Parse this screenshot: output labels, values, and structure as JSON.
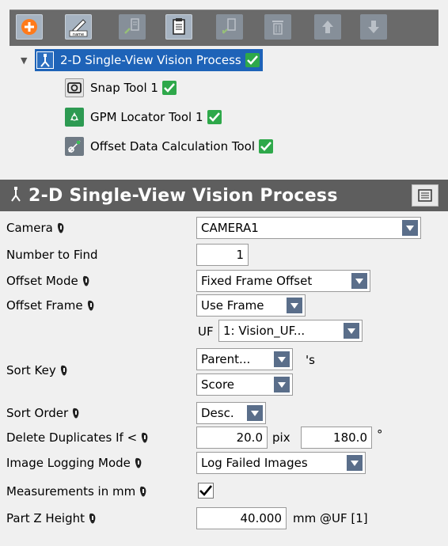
{
  "toolbar": {
    "buttons": [
      {
        "name": "add-icon",
        "enabled": true
      },
      {
        "name": "rename-icon",
        "label": "name",
        "enabled": true
      },
      {
        "name": "cut-icon",
        "enabled": false
      },
      {
        "name": "copy-icon",
        "enabled": true
      },
      {
        "name": "paste-icon",
        "enabled": false
      },
      {
        "name": "delete-icon",
        "enabled": false
      },
      {
        "name": "move-up-icon",
        "enabled": false
      },
      {
        "name": "move-down-icon",
        "enabled": false
      }
    ]
  },
  "tree": {
    "root": {
      "label": "2-D Single-View Vision Process",
      "icon": "vision-process-icon",
      "status": "ok"
    },
    "children": [
      {
        "label": "Snap Tool 1",
        "icon": "camera-icon",
        "status": "ok"
      },
      {
        "label": "GPM Locator Tool 1",
        "icon": "locator-icon",
        "status": "ok"
      },
      {
        "label": "Offset Data Calculation Tool",
        "icon": "offset-calc-icon",
        "status": "ok"
      }
    ]
  },
  "panel": {
    "title": "2-D Single-View Vision Process"
  },
  "form": {
    "camera": {
      "label": "Camera",
      "value": "CAMERA1"
    },
    "number_to_find": {
      "label": "Number to Find",
      "value": "1"
    },
    "offset_mode": {
      "label": "Offset Mode",
      "value": "Fixed Frame Offset"
    },
    "offset_frame": {
      "label": "Offset Frame",
      "value": "Use Frame",
      "uf_prefix": "UF",
      "uf_value": "1: Vision_UF..."
    },
    "sort_key": {
      "label": "Sort Key",
      "value1": "Parent...",
      "suffix": "'s",
      "value2": "Score"
    },
    "sort_order": {
      "label": "Sort Order",
      "value": "Desc."
    },
    "delete_duplicates": {
      "label": "Delete Duplicates If <",
      "pos_value": "20.0",
      "pos_unit": "pix",
      "angle_value": "180.0",
      "angle_unit": "°"
    },
    "image_logging": {
      "label": "Image Logging Mode",
      "value": "Log Failed Images"
    },
    "measurements_mm": {
      "label": "Measurements in mm",
      "checked": true
    },
    "part_z_height": {
      "label": "Part Z Height",
      "value": "40.000",
      "unit": "mm @UF [1]"
    }
  },
  "colors": {
    "accent": "#1e63b8",
    "ok": "#2ea84a",
    "toolbar": "#6a6a6a",
    "header": "#5e5e5e"
  }
}
